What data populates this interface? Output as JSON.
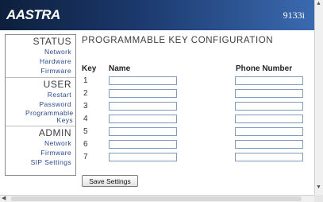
{
  "header": {
    "logo": "AASTRA",
    "model": "9133i"
  },
  "sidebar": {
    "sections": [
      {
        "title": "STATUS",
        "items": [
          "Network",
          "Hardware",
          "Firmware"
        ]
      },
      {
        "title": "USER",
        "items": [
          "Restart",
          "Password",
          "Programmable Keys"
        ]
      },
      {
        "title": "ADMIN",
        "items": [
          "Network",
          "Firmware",
          "SIP Settings"
        ]
      }
    ]
  },
  "main": {
    "title": "PROGRAMMABLE KEY CONFIGURATION",
    "headers": {
      "key": "Key",
      "name": "Name",
      "phone": "Phone Number"
    },
    "keys": [
      "1",
      "2",
      "3",
      "4",
      "5",
      "6",
      "7"
    ],
    "save_label": "Save Settings"
  },
  "scrollbars": {
    "up_icon": "arrow-up-icon",
    "down_icon": "arrow-down-icon",
    "left_icon": "arrow-left-icon"
  },
  "colors": {
    "header_dark": "#0d1f3c",
    "header_light": "#3b6ab0",
    "nav_link": "#2a4b8d",
    "field_border": "#7f9db9"
  }
}
